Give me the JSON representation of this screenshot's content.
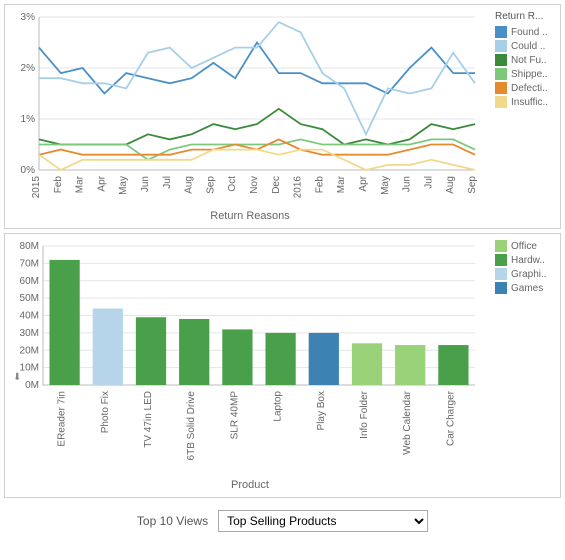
{
  "chart_data": [
    {
      "type": "line",
      "title": "Return Reasons",
      "xlabel": "Return Reasons",
      "ylabel": "",
      "ylim": [
        0,
        3
      ],
      "y_format": "percent",
      "legend_title": "Return R...",
      "categories": [
        "2015",
        "Feb",
        "Mar",
        "Apr",
        "May",
        "Jun",
        "Jul",
        "Aug",
        "Sep",
        "Oct",
        "Nov",
        "Dec",
        "2016",
        "Feb",
        "Mar",
        "Apr",
        "May",
        "Jun",
        "Jul",
        "Aug",
        "Sep"
      ],
      "series": [
        {
          "name": "Found ..",
          "truncated": true,
          "color": "#4a90c7",
          "values": [
            2.4,
            1.9,
            2.0,
            1.5,
            1.9,
            1.8,
            1.7,
            1.8,
            2.1,
            1.8,
            2.5,
            1.9,
            1.9,
            1.7,
            1.7,
            1.7,
            1.5,
            2.0,
            2.4,
            1.9,
            1.9
          ]
        },
        {
          "name": "Could ..",
          "truncated": true,
          "color": "#a6d0e8",
          "values": [
            1.8,
            1.8,
            1.7,
            1.7,
            1.6,
            2.3,
            2.4,
            2.0,
            2.2,
            2.4,
            2.4,
            2.9,
            2.7,
            1.9,
            1.6,
            0.7,
            1.6,
            1.5,
            1.6,
            2.3,
            1.7
          ]
        },
        {
          "name": "Not Fu..",
          "truncated": true,
          "color": "#3a8a3a",
          "values": [
            0.6,
            0.5,
            0.5,
            0.5,
            0.5,
            0.7,
            0.6,
            0.7,
            0.9,
            0.8,
            0.9,
            1.2,
            0.9,
            0.8,
            0.5,
            0.6,
            0.5,
            0.6,
            0.9,
            0.8,
            0.9
          ]
        },
        {
          "name": "Shippe..",
          "truncated": true,
          "color": "#7cc97c",
          "values": [
            0.5,
            0.5,
            0.5,
            0.5,
            0.5,
            0.2,
            0.4,
            0.5,
            0.5,
            0.5,
            0.5,
            0.5,
            0.6,
            0.5,
            0.5,
            0.5,
            0.5,
            0.5,
            0.6,
            0.6,
            0.4
          ]
        },
        {
          "name": "Defecti..",
          "truncated": true,
          "color": "#e68a2e",
          "values": [
            0.3,
            0.4,
            0.3,
            0.3,
            0.3,
            0.3,
            0.3,
            0.4,
            0.4,
            0.5,
            0.4,
            0.6,
            0.4,
            0.3,
            0.3,
            0.3,
            0.3,
            0.4,
            0.5,
            0.5,
            0.3
          ]
        },
        {
          "name": "Insuffic..",
          "truncated": true,
          "color": "#f2d98a",
          "values": [
            0.3,
            0.0,
            0.2,
            0.2,
            0.2,
            0.2,
            0.2,
            0.2,
            0.4,
            0.4,
            0.4,
            0.3,
            0.4,
            0.4,
            0.2,
            0.0,
            0.1,
            0.1,
            0.2,
            0.1,
            0.0
          ]
        }
      ]
    },
    {
      "type": "bar",
      "title": "Product",
      "xlabel": "Product",
      "ylabel": "",
      "ylim": [
        0,
        80
      ],
      "y_unit": "M",
      "legend_title": "",
      "categories": [
        "EReader 7in",
        "Photo Fix",
        "TV 47in LED",
        "6TB Solid Drive",
        "SLR 40MP",
        "Laptop",
        "Play Box",
        "Info Folder",
        "Web Calendar",
        "Car Charger"
      ],
      "values": [
        72,
        44,
        39,
        38,
        32,
        30,
        30,
        24,
        23,
        23
      ],
      "category_map": [
        "Hardw..",
        "Graphi..",
        "Hardw..",
        "Hardw..",
        "Hardw..",
        "Hardw..",
        "Games",
        "Office",
        "Office",
        "Hardw.."
      ],
      "legend_categories": [
        {
          "name": "Office",
          "color": "#9ad27a"
        },
        {
          "name": "Hardw..",
          "truncated": true,
          "color": "#4aa04a"
        },
        {
          "name": "Graphi..",
          "truncated": true,
          "color": "#b7d5ea"
        },
        {
          "name": "Games",
          "color": "#3d82b3"
        }
      ]
    }
  ],
  "footer": {
    "label": "Top 10 Views",
    "selected": "Top Selling Products"
  },
  "icons": {
    "download": "⬇"
  }
}
